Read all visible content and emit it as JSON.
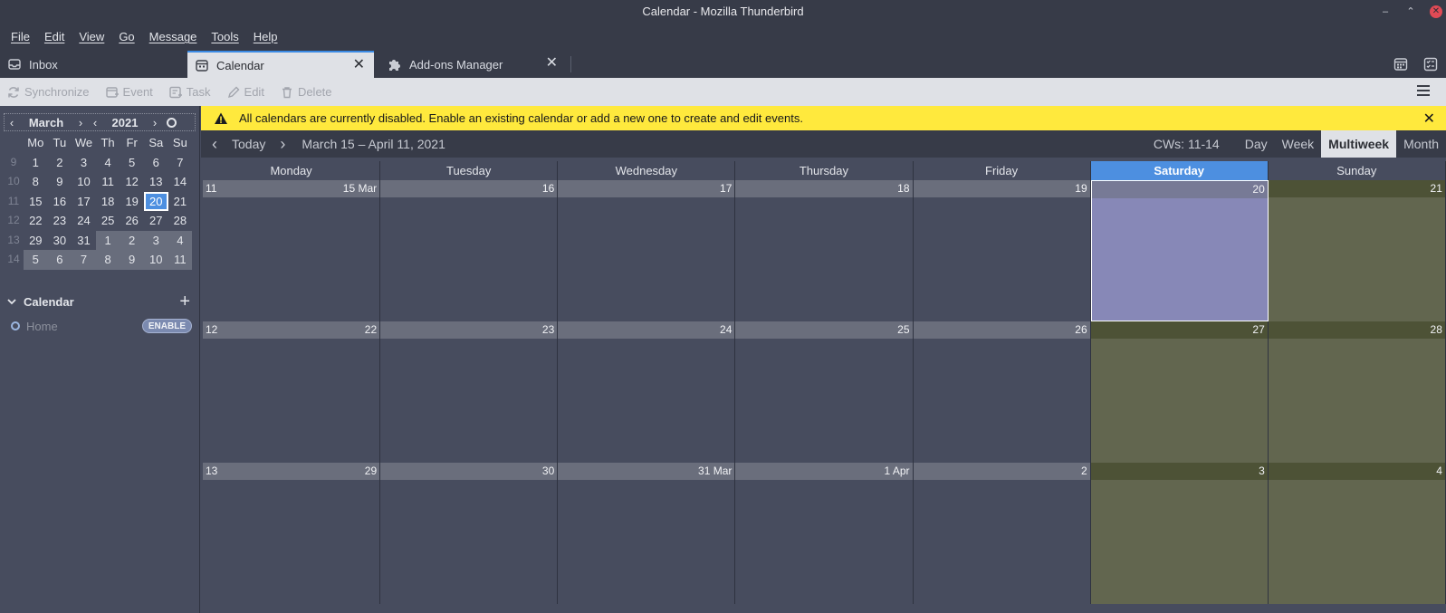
{
  "window": {
    "title": "Calendar - Mozilla Thunderbird",
    "minimize": "–",
    "restore": "⌃",
    "close": "✕"
  },
  "menubar": [
    "File",
    "Edit",
    "View",
    "Go",
    "Message",
    "Tools",
    "Help"
  ],
  "tabs": [
    {
      "label": "Inbox",
      "icon": "inbox-icon"
    },
    {
      "label": "Calendar",
      "icon": "calendar-icon",
      "close": "✕"
    },
    {
      "label": "Add-ons Manager",
      "icon": "puzzle-icon",
      "close": "✕"
    }
  ],
  "toolbar": {
    "synchronize": "Synchronize",
    "event": "Event",
    "task": "Task",
    "edit": "Edit",
    "delete": "Delete"
  },
  "minicalendar": {
    "month": "March",
    "year": "2021",
    "prev": "‹",
    "next": "›",
    "daynames": [
      "Mo",
      "Tu",
      "We",
      "Th",
      "Fr",
      "Sa",
      "Su"
    ],
    "weeks": [
      {
        "wk": "9",
        "days": [
          "1",
          "2",
          "3",
          "4",
          "5",
          "6",
          "7"
        ]
      },
      {
        "wk": "10",
        "days": [
          "8",
          "9",
          "10",
          "11",
          "12",
          "13",
          "14"
        ]
      },
      {
        "wk": "11",
        "days": [
          "15",
          "16",
          "17",
          "18",
          "19",
          "20",
          "21"
        ]
      },
      {
        "wk": "12",
        "days": [
          "22",
          "23",
          "24",
          "25",
          "26",
          "27",
          "28"
        ]
      },
      {
        "wk": "13",
        "days": [
          "29",
          "30",
          "31",
          "1",
          "2",
          "3",
          "4"
        ]
      },
      {
        "wk": "14",
        "days": [
          "5",
          "6",
          "7",
          "8",
          "9",
          "10",
          "11"
        ]
      }
    ]
  },
  "calendars": {
    "section_title": "Calendar",
    "add": "+",
    "items": [
      {
        "name": "Home",
        "action": "ENABLE"
      }
    ]
  },
  "notification": {
    "message": "All calendars are currently disabled. Enable an existing calendar or add a new one to create and edit events.",
    "close": "✕"
  },
  "nav": {
    "prev": "‹",
    "today": "Today",
    "next": "›",
    "range": "March 15 – April 11, 2021",
    "cws": "CWs: 11-14",
    "views": [
      "Day",
      "Week",
      "Multiweek",
      "Month"
    ]
  },
  "grid": {
    "day_headers": [
      "Monday",
      "Tuesday",
      "Wednesday",
      "Thursday",
      "Friday",
      "Saturday",
      "Sunday"
    ],
    "weeks": [
      {
        "cw": "11",
        "days": [
          "15 Mar",
          "16",
          "17",
          "18",
          "19",
          "20",
          "21"
        ]
      },
      {
        "cw": "12",
        "days": [
          "22",
          "23",
          "24",
          "25",
          "26",
          "27",
          "28"
        ]
      },
      {
        "cw": "13",
        "days": [
          "29",
          "30",
          "31 Mar",
          "1 Apr",
          "2",
          "3",
          "4"
        ]
      }
    ]
  }
}
